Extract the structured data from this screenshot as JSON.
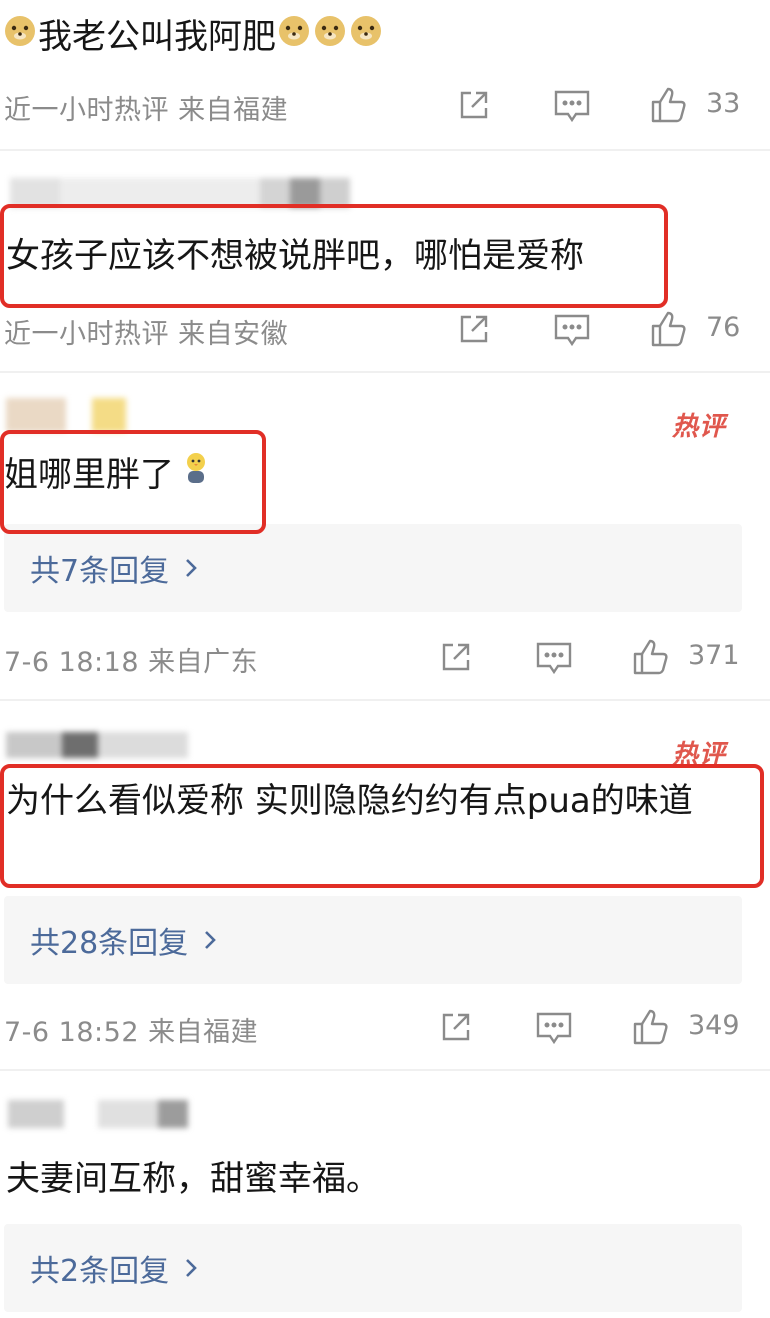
{
  "comments": [
    {
      "text": "我老公叫我阿肥",
      "meta": "近一小时热评  来自福建",
      "likes": "33"
    },
    {
      "text": "女孩子应该不想被说胖吧，哪怕是爱称",
      "meta": "近一小时热评  来自安徽",
      "likes": "76"
    },
    {
      "badge": "热评",
      "text": "姐哪里胖了",
      "replies": "共7条回复",
      "meta": "7-6 18:18  来自广东",
      "likes": "371"
    },
    {
      "badge": "热评",
      "text": "为什么看似爱称 实则隐隐约约有点pua的味道",
      "replies": "共28条回复",
      "meta": "7-6 18:52  来自福建",
      "likes": "349"
    },
    {
      "text": "夫妻间互称，甜蜜幸福。",
      "replies": "共2条回复"
    }
  ],
  "icons": {
    "share": "share-icon",
    "comment": "comment-icon",
    "like": "thumbs-up-icon",
    "chevron": "chevron-right-icon",
    "emoji": "doge-emoji-icon"
  },
  "colors": {
    "highlight": "#e12e26",
    "reply_link": "#4c6a9a",
    "hot_badge": "#e0574d",
    "meta_text": "#8b8b8b"
  }
}
